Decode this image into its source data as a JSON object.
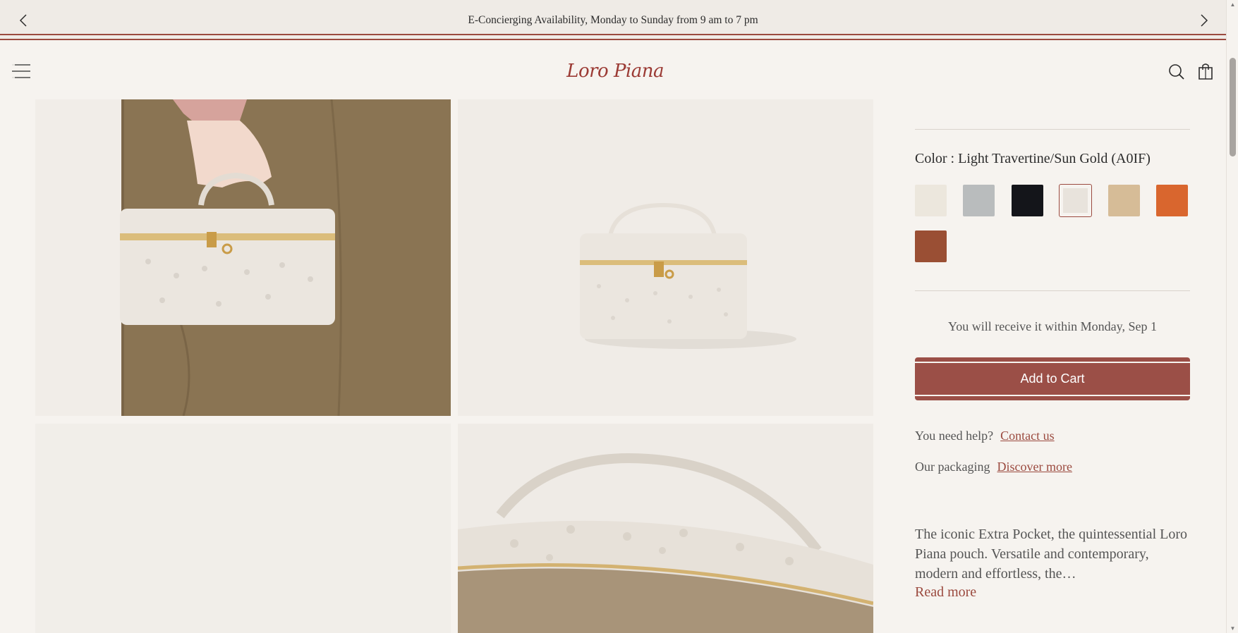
{
  "announcement": {
    "text": "E-Concierging Availability, Monday to Sunday from 9 am to 7 pm",
    "prev_icon": "chevron-left-icon",
    "next_icon": "chevron-right-icon"
  },
  "header": {
    "logo_text": "Loro Piana",
    "menu_icon": "hamburger-menu-icon",
    "search_icon": "search-icon",
    "bag_icon": "shopping-bag-icon"
  },
  "gallery": {
    "images": [
      "model holding white ostrich pouch",
      "white ostrich pouch product shot",
      "blank image",
      "pouch handle close-up"
    ]
  },
  "product": {
    "color_label": "Color : Light Travertine/Sun Gold (A0IF)",
    "swatches": [
      {
        "color": "#ece7dd",
        "selected": false
      },
      {
        "color": "#b9bcbd",
        "selected": false
      },
      {
        "color": "#14151a",
        "selected": false
      },
      {
        "color": "#e8e3dc",
        "selected": true
      },
      {
        "color": "#d6bc97",
        "selected": false
      },
      {
        "color": "#d9662e",
        "selected": false
      },
      {
        "color": "#9a4f34",
        "selected": false
      }
    ],
    "delivery_text": "You will receive it within Monday, Sep 1",
    "add_to_cart": "Add to Cart",
    "help_label": "You need help?",
    "contact_link": "Contact us",
    "packaging_label": "Our packaging",
    "packaging_link": "Discover more",
    "description": "The iconic Extra Pocket, the quintessential Loro Piana pouch. Versatile and contemporary, modern and effortless, the…",
    "read_more": "Read more"
  },
  "colors": {
    "accent": "#9b4a3f",
    "background": "#f6f3ef"
  }
}
